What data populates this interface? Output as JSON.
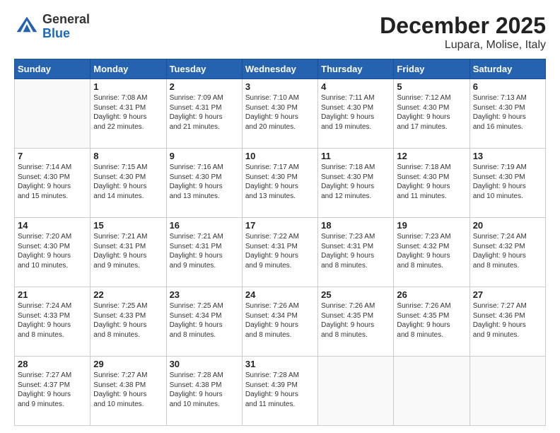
{
  "header": {
    "logo_general": "General",
    "logo_blue": "Blue",
    "title": "December 2025",
    "subtitle": "Lupara, Molise, Italy"
  },
  "weekdays": [
    "Sunday",
    "Monday",
    "Tuesday",
    "Wednesday",
    "Thursday",
    "Friday",
    "Saturday"
  ],
  "weeks": [
    [
      {
        "day": "",
        "info": ""
      },
      {
        "day": "1",
        "info": "Sunrise: 7:08 AM\nSunset: 4:31 PM\nDaylight: 9 hours\nand 22 minutes."
      },
      {
        "day": "2",
        "info": "Sunrise: 7:09 AM\nSunset: 4:31 PM\nDaylight: 9 hours\nand 21 minutes."
      },
      {
        "day": "3",
        "info": "Sunrise: 7:10 AM\nSunset: 4:30 PM\nDaylight: 9 hours\nand 20 minutes."
      },
      {
        "day": "4",
        "info": "Sunrise: 7:11 AM\nSunset: 4:30 PM\nDaylight: 9 hours\nand 19 minutes."
      },
      {
        "day": "5",
        "info": "Sunrise: 7:12 AM\nSunset: 4:30 PM\nDaylight: 9 hours\nand 17 minutes."
      },
      {
        "day": "6",
        "info": "Sunrise: 7:13 AM\nSunset: 4:30 PM\nDaylight: 9 hours\nand 16 minutes."
      }
    ],
    [
      {
        "day": "7",
        "info": "Sunrise: 7:14 AM\nSunset: 4:30 PM\nDaylight: 9 hours\nand 15 minutes."
      },
      {
        "day": "8",
        "info": "Sunrise: 7:15 AM\nSunset: 4:30 PM\nDaylight: 9 hours\nand 14 minutes."
      },
      {
        "day": "9",
        "info": "Sunrise: 7:16 AM\nSunset: 4:30 PM\nDaylight: 9 hours\nand 13 minutes."
      },
      {
        "day": "10",
        "info": "Sunrise: 7:17 AM\nSunset: 4:30 PM\nDaylight: 9 hours\nand 13 minutes."
      },
      {
        "day": "11",
        "info": "Sunrise: 7:18 AM\nSunset: 4:30 PM\nDaylight: 9 hours\nand 12 minutes."
      },
      {
        "day": "12",
        "info": "Sunrise: 7:18 AM\nSunset: 4:30 PM\nDaylight: 9 hours\nand 11 minutes."
      },
      {
        "day": "13",
        "info": "Sunrise: 7:19 AM\nSunset: 4:30 PM\nDaylight: 9 hours\nand 10 minutes."
      }
    ],
    [
      {
        "day": "14",
        "info": "Sunrise: 7:20 AM\nSunset: 4:30 PM\nDaylight: 9 hours\nand 10 minutes."
      },
      {
        "day": "15",
        "info": "Sunrise: 7:21 AM\nSunset: 4:31 PM\nDaylight: 9 hours\nand 9 minutes."
      },
      {
        "day": "16",
        "info": "Sunrise: 7:21 AM\nSunset: 4:31 PM\nDaylight: 9 hours\nand 9 minutes."
      },
      {
        "day": "17",
        "info": "Sunrise: 7:22 AM\nSunset: 4:31 PM\nDaylight: 9 hours\nand 9 minutes."
      },
      {
        "day": "18",
        "info": "Sunrise: 7:23 AM\nSunset: 4:31 PM\nDaylight: 9 hours\nand 8 minutes."
      },
      {
        "day": "19",
        "info": "Sunrise: 7:23 AM\nSunset: 4:32 PM\nDaylight: 9 hours\nand 8 minutes."
      },
      {
        "day": "20",
        "info": "Sunrise: 7:24 AM\nSunset: 4:32 PM\nDaylight: 9 hours\nand 8 minutes."
      }
    ],
    [
      {
        "day": "21",
        "info": "Sunrise: 7:24 AM\nSunset: 4:33 PM\nDaylight: 9 hours\nand 8 minutes."
      },
      {
        "day": "22",
        "info": "Sunrise: 7:25 AM\nSunset: 4:33 PM\nDaylight: 9 hours\nand 8 minutes."
      },
      {
        "day": "23",
        "info": "Sunrise: 7:25 AM\nSunset: 4:34 PM\nDaylight: 9 hours\nand 8 minutes."
      },
      {
        "day": "24",
        "info": "Sunrise: 7:26 AM\nSunset: 4:34 PM\nDaylight: 9 hours\nand 8 minutes."
      },
      {
        "day": "25",
        "info": "Sunrise: 7:26 AM\nSunset: 4:35 PM\nDaylight: 9 hours\nand 8 minutes."
      },
      {
        "day": "26",
        "info": "Sunrise: 7:26 AM\nSunset: 4:35 PM\nDaylight: 9 hours\nand 8 minutes."
      },
      {
        "day": "27",
        "info": "Sunrise: 7:27 AM\nSunset: 4:36 PM\nDaylight: 9 hours\nand 9 minutes."
      }
    ],
    [
      {
        "day": "28",
        "info": "Sunrise: 7:27 AM\nSunset: 4:37 PM\nDaylight: 9 hours\nand 9 minutes."
      },
      {
        "day": "29",
        "info": "Sunrise: 7:27 AM\nSunset: 4:38 PM\nDaylight: 9 hours\nand 10 minutes."
      },
      {
        "day": "30",
        "info": "Sunrise: 7:28 AM\nSunset: 4:38 PM\nDaylight: 9 hours\nand 10 minutes."
      },
      {
        "day": "31",
        "info": "Sunrise: 7:28 AM\nSunset: 4:39 PM\nDaylight: 9 hours\nand 11 minutes."
      },
      {
        "day": "",
        "info": ""
      },
      {
        "day": "",
        "info": ""
      },
      {
        "day": "",
        "info": ""
      }
    ]
  ]
}
